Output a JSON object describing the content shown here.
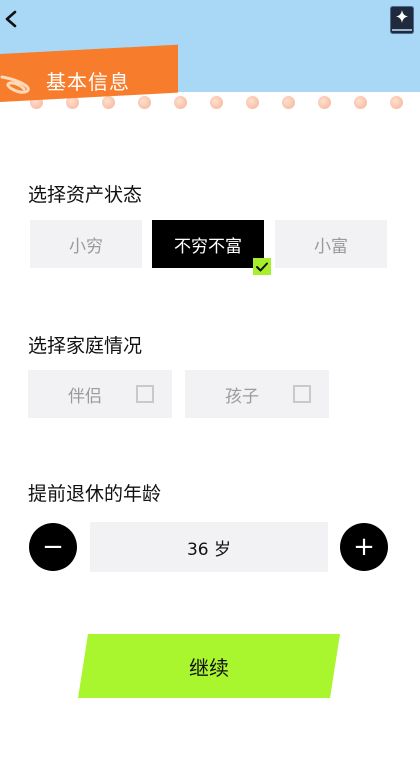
{
  "header": {
    "title": "基本信息"
  },
  "asset_section": {
    "title": "选择资产状态",
    "options": [
      {
        "label": "小穷",
        "selected": false
      },
      {
        "label": "不穷不富",
        "selected": true
      },
      {
        "label": "小富",
        "selected": false
      }
    ]
  },
  "family_section": {
    "title": "选择家庭情况",
    "options": [
      {
        "label": "伴侣",
        "checked": false
      },
      {
        "label": "孩子",
        "checked": false
      }
    ]
  },
  "retire_section": {
    "title": "提前退休的年龄",
    "minus_label": "−",
    "plus_label": "+",
    "age_value": 36,
    "age_unit": "岁",
    "age_display": "36 岁"
  },
  "continue_label": "继续",
  "colors": {
    "header_bg": "#a9d8f7",
    "ribbon": "#f77d2c",
    "accent_green": "#a9f62e",
    "selected_bg": "#000000"
  },
  "icons": {
    "back": "chevron-left-icon",
    "app": "sparkle-icon",
    "check": "checkmark-icon"
  }
}
